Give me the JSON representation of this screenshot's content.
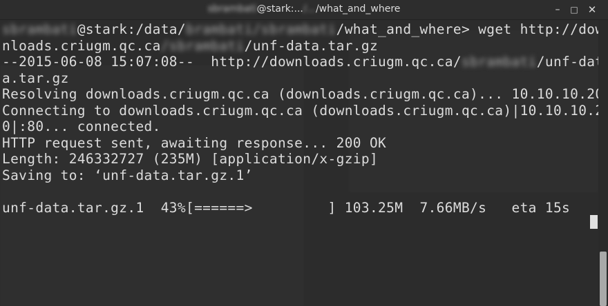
{
  "window": {
    "title_user_redacted": "sbrambati",
    "title_host": "@stark:...",
    "title_mid_redacted": "/...",
    "title_dir": "/what_and_where",
    "controls": {
      "minimize_glyph": "–",
      "maximize_glyph": "□",
      "close_glyph": "✕"
    }
  },
  "terminal": {
    "lines": [
      {
        "segments": [
          {
            "text": "sbrambati",
            "redacted": true
          },
          {
            "text": "@stark:/data/",
            "redacted": false
          },
          {
            "text": "brambati/sbrambati",
            "redacted": true
          },
          {
            "text": "/what_and_where> wget http://dow",
            "redacted": false
          }
        ]
      },
      {
        "segments": [
          {
            "text": "nloads.criugm.qc.ca",
            "redacted": false
          },
          {
            "text": "/sbrambati",
            "redacted": true
          },
          {
            "text": "/unf-data.tar.gz",
            "redacted": false
          }
        ]
      },
      {
        "segments": [
          {
            "text": "--2015-06-08 15:07:08--  http://downloads.criugm.qc.ca/",
            "redacted": false
          },
          {
            "text": "sbrambati",
            "redacted": true
          },
          {
            "text": "/unf-dat",
            "redacted": false
          }
        ]
      },
      {
        "segments": [
          {
            "text": "a.tar.gz",
            "redacted": false
          }
        ]
      },
      {
        "segments": [
          {
            "text": "Resolving downloads.criugm.qc.ca (downloads.criugm.qc.ca)... 10.10.10.20",
            "redacted": false
          }
        ]
      },
      {
        "segments": [
          {
            "text": "Connecting to downloads.criugm.qc.ca (downloads.criugm.qc.ca)|10.10.10.2",
            "redacted": false
          }
        ]
      },
      {
        "segments": [
          {
            "text": "0|:80... connected.",
            "redacted": false
          }
        ]
      },
      {
        "segments": [
          {
            "text": "HTTP request sent, awaiting response... 200 OK",
            "redacted": false
          }
        ]
      },
      {
        "segments": [
          {
            "text": "Length: 246332727 (235M) [application/x-gzip]",
            "redacted": false
          }
        ]
      },
      {
        "segments": [
          {
            "text": "Saving to: ‘unf-data.tar.gz.1’",
            "redacted": false
          }
        ]
      },
      {
        "segments": [
          {
            "text": "",
            "redacted": false
          }
        ]
      },
      {
        "segments": [
          {
            "text": "unf-data.tar.gz.1  43%[======>         ] 103.25M  7.66MB/s   eta 15s",
            "redacted": false
          }
        ]
      }
    ],
    "download_progress": 0.43
  }
}
